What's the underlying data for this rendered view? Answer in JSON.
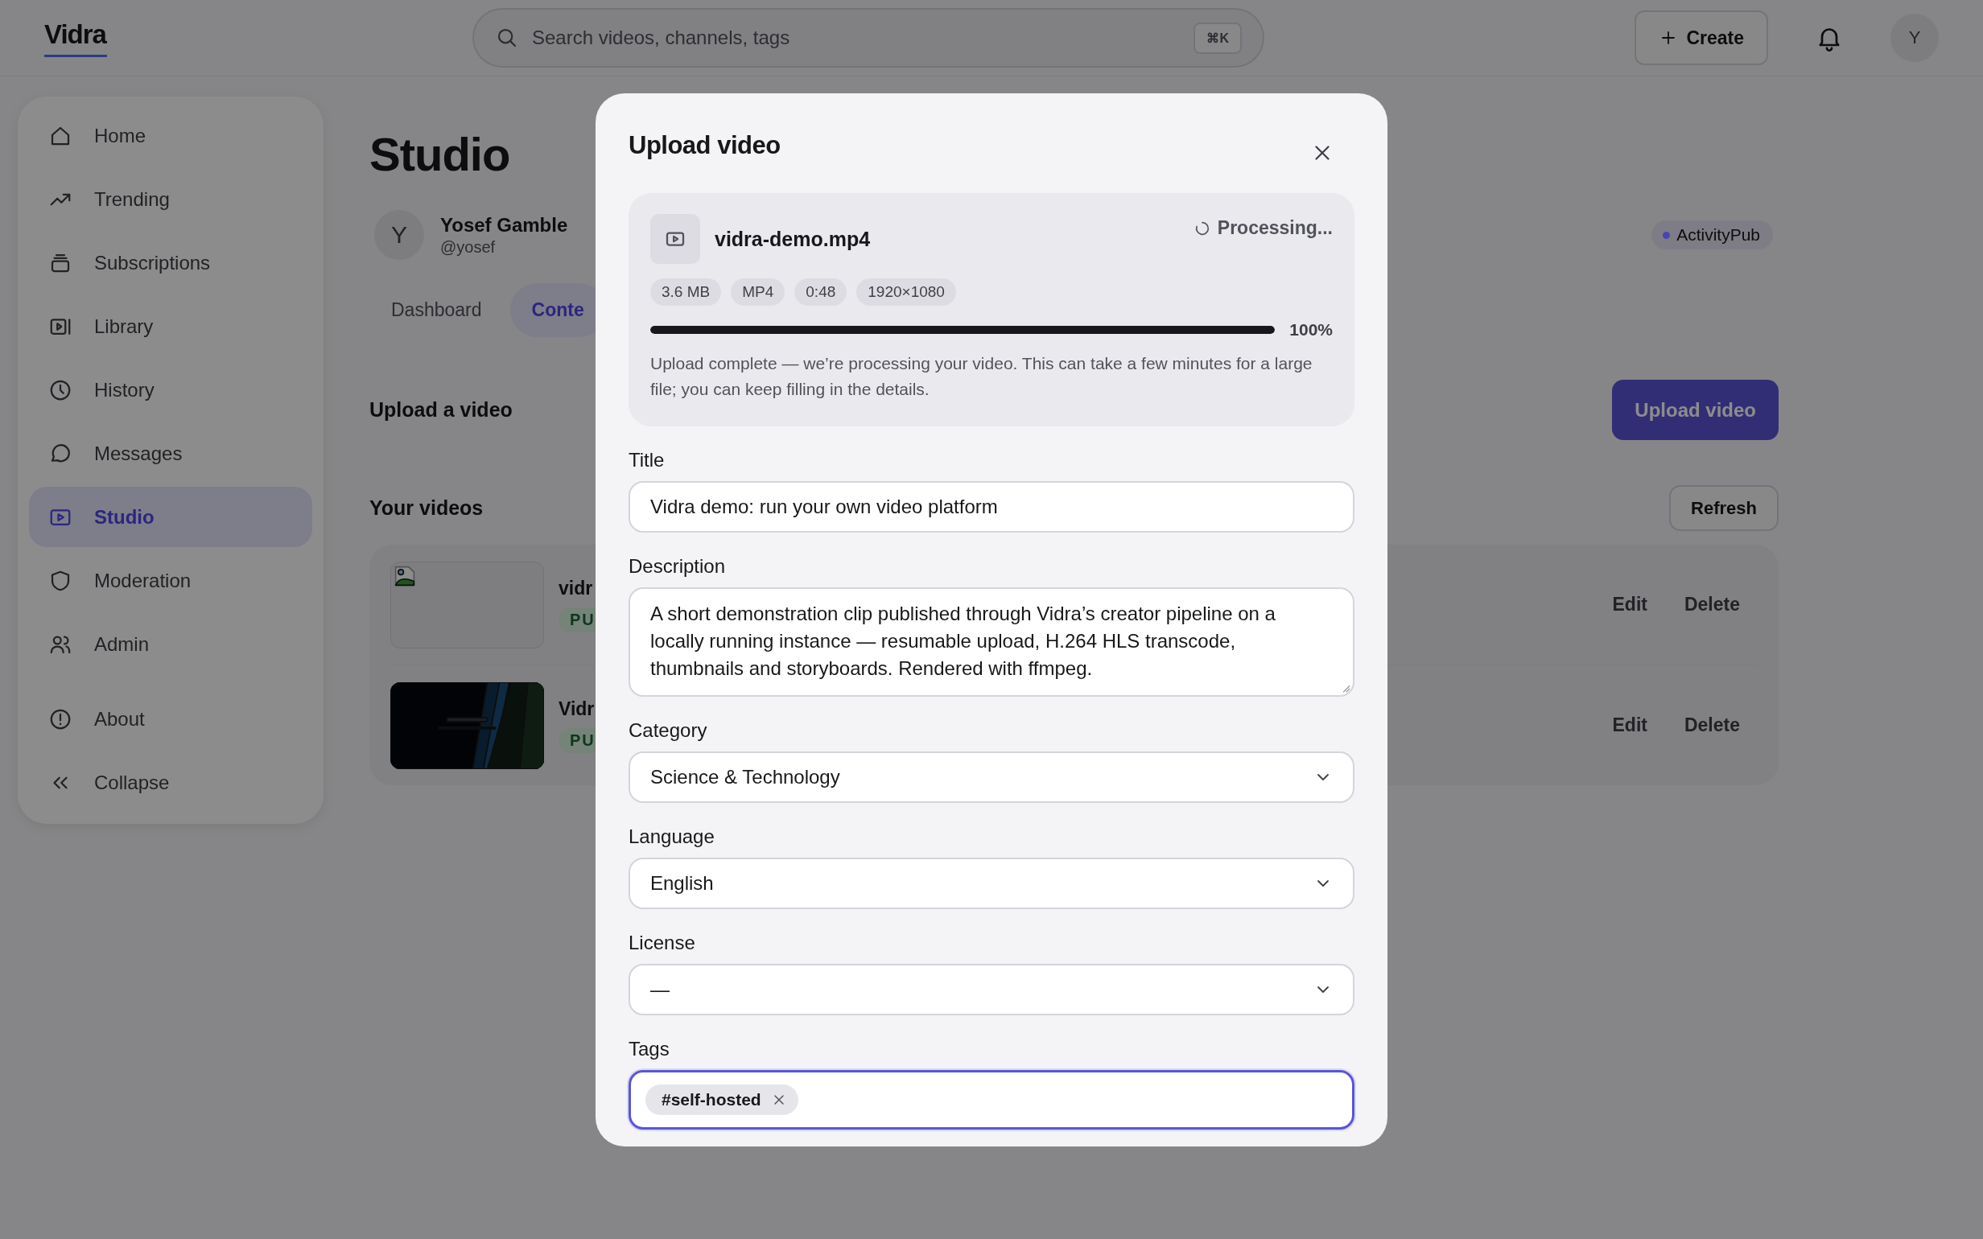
{
  "topbar": {
    "logo": "Vidra",
    "search": {
      "placeholder": "Search videos, channels, tags",
      "shortcut": "⌘K"
    },
    "create_button": "Create",
    "avatar": "Y"
  },
  "sidebar": {
    "items": [
      {
        "label": "Home",
        "selected": false
      },
      {
        "label": "Trending",
        "selected": false
      },
      {
        "label": "Subscriptions",
        "selected": false
      },
      {
        "label": "Library",
        "selected": false
      },
      {
        "label": "History",
        "selected": false
      },
      {
        "label": "Messages",
        "selected": false
      },
      {
        "label": "Studio",
        "selected": true
      },
      {
        "label": "Moderation",
        "selected": false
      },
      {
        "label": "Admin",
        "selected": false
      }
    ],
    "footer_items": [
      {
        "label": "About"
      },
      {
        "label": "Collapse"
      }
    ]
  },
  "studio": {
    "title": "Studio",
    "profile": {
      "avatar": "Y",
      "name": "Yosef Gamble",
      "handle": "@yosef"
    },
    "federation_badge": {
      "label": "ActivityPub",
      "color": "#4845b5"
    },
    "tabs": [
      {
        "label": "Dashboard",
        "selected": false
      },
      {
        "label": "Conte",
        "selected": true
      }
    ],
    "upload_section": {
      "heading": "Upload a video",
      "button": "Upload video"
    },
    "videos_section": {
      "heading": "Your videos",
      "refresh_button": "Refresh",
      "rows": [
        {
          "thumbnail": {
            "kind": "broken"
          },
          "title": "vidr",
          "status": "PU",
          "edit": "Edit",
          "delete": "Delete"
        },
        {
          "title": "Vidr",
          "status": "PU",
          "edit": "Edit",
          "delete": "Delete"
        }
      ]
    }
  },
  "modal": {
    "title": "Upload video",
    "file": {
      "name": "vidra-demo.mp4",
      "status": "Processing...",
      "chips": [
        "3.6 MB",
        "MP4",
        "0:48",
        "1920×1080"
      ],
      "level": 1,
      "percent": "100%",
      "note": "Upload complete — we’re processing your video. This can take a few minutes for a large file; you can keep filling in the details."
    },
    "fields": [
      {
        "kind": "text",
        "label": "Title",
        "value": "Vidra demo: run your own video platform"
      },
      {
        "kind": "textarea",
        "label": "Description",
        "value": "A short demonstration clip published through Vidra’s creator pipeline on a locally running instance — resumable upload, H.264 HLS transcode, thumbnails and storyboards. Rendered with ffmpeg."
      },
      {
        "kind": "select",
        "label": "Category",
        "value": "Science & Technology"
      },
      {
        "kind": "select",
        "label": "Language",
        "value": "English"
      },
      {
        "kind": "select",
        "label": "License",
        "value": "—"
      },
      {
        "kind": "tags",
        "label": "Tags",
        "focused": true,
        "tags": [
          "#self-hosted"
        ]
      }
    ]
  }
}
